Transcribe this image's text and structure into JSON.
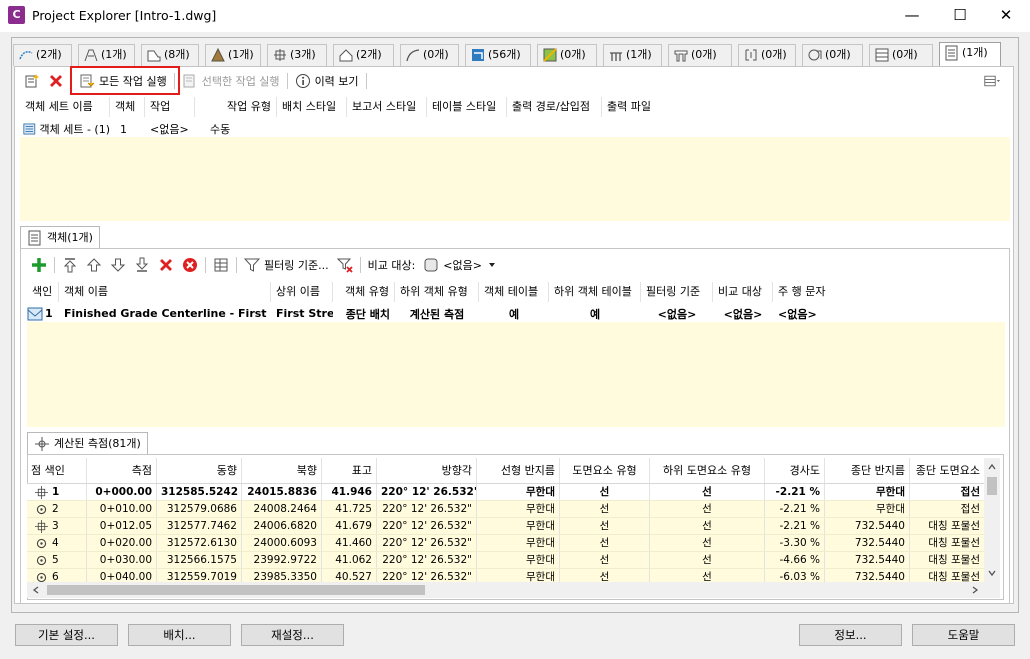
{
  "window": {
    "title": "Project Explorer [Intro-1.dwg]",
    "app_icon_letter": "C",
    "minimize": "—",
    "maximize": "☐",
    "close": "✕"
  },
  "top_tabs": [
    {
      "label": "(2개)",
      "icon": "alignment-icon"
    },
    {
      "label": "(1개)",
      "icon": "corridor-icon"
    },
    {
      "label": "(8개)",
      "icon": "profile-icon"
    },
    {
      "label": "(1개)",
      "icon": "surface-icon"
    },
    {
      "label": "(3개)",
      "icon": "assembly-icon"
    },
    {
      "label": "(2개)",
      "icon": "pipe-icon"
    },
    {
      "label": "(0개)",
      "icon": "feature-line-icon"
    },
    {
      "label": "(56개)",
      "icon": "section-icon"
    },
    {
      "label": "(0개)",
      "icon": "parcel-icon"
    },
    {
      "label": "(1개)",
      "icon": "bridge-icon"
    },
    {
      "label": "(0개)",
      "icon": "structure-icon"
    },
    {
      "label": "(0개)",
      "icon": "sample-line-icon"
    },
    {
      "label": "(0개)",
      "icon": "view-frame-icon"
    },
    {
      "label": "(0개)",
      "icon": "table-icon"
    },
    {
      "label": "(1개)",
      "icon": "report-icon"
    }
  ],
  "toolbar1": {
    "run_all": "모든 작업 실행",
    "run_selected": "선택한 작업 실행",
    "history": "이력 보기"
  },
  "set_grid": {
    "headers": [
      "객체 세트 이름",
      "객체",
      "작업",
      "작업 유형",
      "배치 스타일",
      "보고서 스타일",
      "테이블 스타일",
      "출력 경로/삽입점",
      "출력 파일"
    ],
    "row": {
      "name": "객체 세트 - (1)",
      "count": "1",
      "task": "<없음>",
      "task_type": "수동"
    }
  },
  "objects_tab": {
    "label": "객체(1개)"
  },
  "toolbar2": {
    "filter": "필터링 기준...",
    "compare_label": "비교 대상:",
    "compare_value": "<없음>"
  },
  "obj_grid": {
    "headers": [
      "색인",
      "객체 이름",
      "상위 이름",
      "객체 유형",
      "하위 객체 유형",
      "객체 테이블",
      "하위 객체 테이블",
      "필터링 기준",
      "비교 대상",
      "주 행 문자"
    ],
    "row": {
      "index": "1",
      "name": "Finished Grade Centerline - First Street",
      "parent": "First Street",
      "type": "종단 배치",
      "sub_type": "계산된 측점",
      "table": "예",
      "sub_table": "예",
      "filter": "<없음>",
      "compare": "<없음>",
      "main_text": "<없음>"
    }
  },
  "stations_tab": {
    "label": "계산된 측점(81개)"
  },
  "station_grid": {
    "headers": [
      "점 색인",
      "측점",
      "동향",
      "북향",
      "표고",
      "방향각",
      "선형 반지름",
      "도면요소 유형",
      "하위 도면요소 유형",
      "경사도",
      "종단 반지름",
      "종단 도면요소"
    ],
    "rows": [
      {
        "idx": "1",
        "station": "0+000.00",
        "easting": "312585.5242",
        "northing": "24015.8836",
        "elev": "41.946",
        "bearing": "220° 12' 26.532\"",
        "radius": "무한대",
        "elem": "선",
        "sub_elem": "선",
        "grade": "-2.21 %",
        "vradius": "무한대",
        "velem": "접선"
      },
      {
        "idx": "2",
        "station": "0+010.00",
        "easting": "312579.0686",
        "northing": "24008.2464",
        "elev": "41.725",
        "bearing": "220° 12' 26.532\"",
        "radius": "무한대",
        "elem": "선",
        "sub_elem": "선",
        "grade": "-2.21 %",
        "vradius": "무한대",
        "velem": "접선"
      },
      {
        "idx": "3",
        "station": "0+012.05",
        "easting": "312577.7462",
        "northing": "24006.6820",
        "elev": "41.679",
        "bearing": "220° 12' 26.532\"",
        "radius": "무한대",
        "elem": "선",
        "sub_elem": "선",
        "grade": "-2.21 %",
        "vradius": "732.5440",
        "velem": "대칭 포물선"
      },
      {
        "idx": "4",
        "station": "0+020.00",
        "easting": "312572.6130",
        "northing": "24000.6093",
        "elev": "41.460",
        "bearing": "220° 12' 26.532\"",
        "radius": "무한대",
        "elem": "선",
        "sub_elem": "선",
        "grade": "-3.30 %",
        "vradius": "732.5440",
        "velem": "대칭 포물선"
      },
      {
        "idx": "5",
        "station": "0+030.00",
        "easting": "312566.1575",
        "northing": "23992.9722",
        "elev": "41.062",
        "bearing": "220° 12' 26.532\"",
        "radius": "무한대",
        "elem": "선",
        "sub_elem": "선",
        "grade": "-4.66 %",
        "vradius": "732.5440",
        "velem": "대칭 포물선"
      },
      {
        "idx": "6",
        "station": "0+040.00",
        "easting": "312559.7019",
        "northing": "23985.3350",
        "elev": "40.527",
        "bearing": "220° 12' 26.532\"",
        "radius": "무한대",
        "elem": "선",
        "sub_elem": "선",
        "grade": "-6.03 %",
        "vradius": "732.5440",
        "velem": "대칭 포물선"
      }
    ]
  },
  "footer": {
    "settings": "기본 설정...",
    "layout": "배치...",
    "reset": "재설정...",
    "info": "정보...",
    "help": "도움말"
  },
  "colors": {
    "highlight": "#e41b1b",
    "row_bg": "#fffbdc",
    "accent": "#2e7bbf"
  }
}
